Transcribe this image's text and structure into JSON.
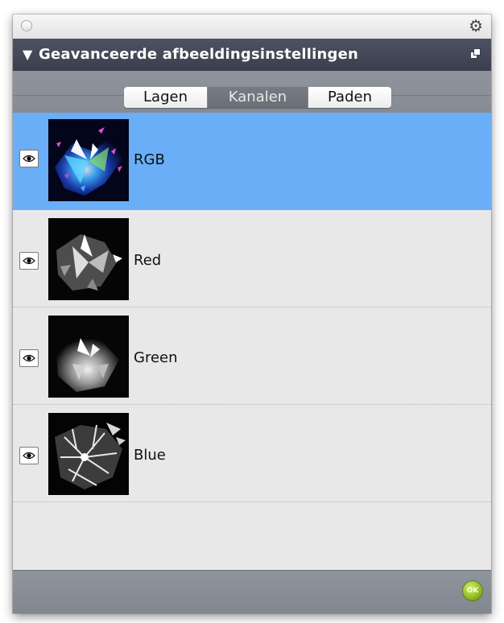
{
  "panel": {
    "title": "Geavanceerde afbeeldingsinstellingen",
    "collapse_icon": "triangle-down-icon",
    "window_icon": "circle-button-icon",
    "settings_icon": "gear-icon",
    "popout_icon": "popout-icon"
  },
  "tabs": [
    {
      "label": "Lagen",
      "active": false
    },
    {
      "label": "Kanalen",
      "active": true
    },
    {
      "label": "Paden",
      "active": false
    }
  ],
  "channels": [
    {
      "label": "RGB",
      "selected": true,
      "visible": true,
      "visibility_icon": "eye-icon"
    },
    {
      "label": "Red",
      "selected": false,
      "visible": true,
      "visibility_icon": "eye-icon"
    },
    {
      "label": "Green",
      "selected": false,
      "visible": true,
      "visibility_icon": "eye-icon"
    },
    {
      "label": "Blue",
      "selected": false,
      "visible": true,
      "visibility_icon": "eye-icon"
    }
  ],
  "footer": {
    "ok_label": "OK",
    "ok_icon": "ok-circle-icon"
  },
  "colors": {
    "selection": "#6aaef7",
    "header_bg": "#3a3e4c",
    "ok_green": "#86b51a"
  }
}
